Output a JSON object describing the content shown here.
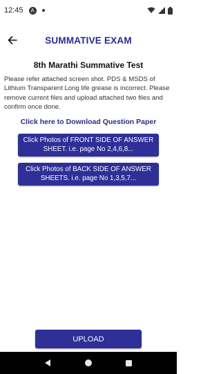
{
  "status_bar": {
    "time": "12:45",
    "app_icon_glyph": "A",
    "icons": [
      "app-notification-icon",
      "dot-icon",
      "wifi-icon",
      "signal-icon",
      "battery-icon"
    ]
  },
  "app_bar": {
    "title": "SUMMATIVE EXAM",
    "back_icon": "back-arrow-icon"
  },
  "content": {
    "exam_title": "8th Marathi Summative Test",
    "instructions": "Please refer attached screen shot. PDS & MSDS of Lithium Transparent Long life grease is incorrect. Please remove current files and upload attached two files and confirm once done.",
    "download_link": "Click here to Download Question Paper",
    "front_button": "Click Photos of FRONT SIDE OF ANSWER SHEET. i.e. page No 2,4,6,8...",
    "back_button": "Click Photos of BACK SIDE OF ANSWER SHEETS. i.e. page No 1,3,5,7...",
    "upload_button": "UPLOAD"
  },
  "nav_bar": {
    "icons": [
      "back-triangle-icon",
      "home-circle-icon",
      "recents-square-icon"
    ]
  },
  "colors": {
    "primary": "#2e2f97",
    "title": "#2b2a8f",
    "nav_bg": "#000000"
  }
}
